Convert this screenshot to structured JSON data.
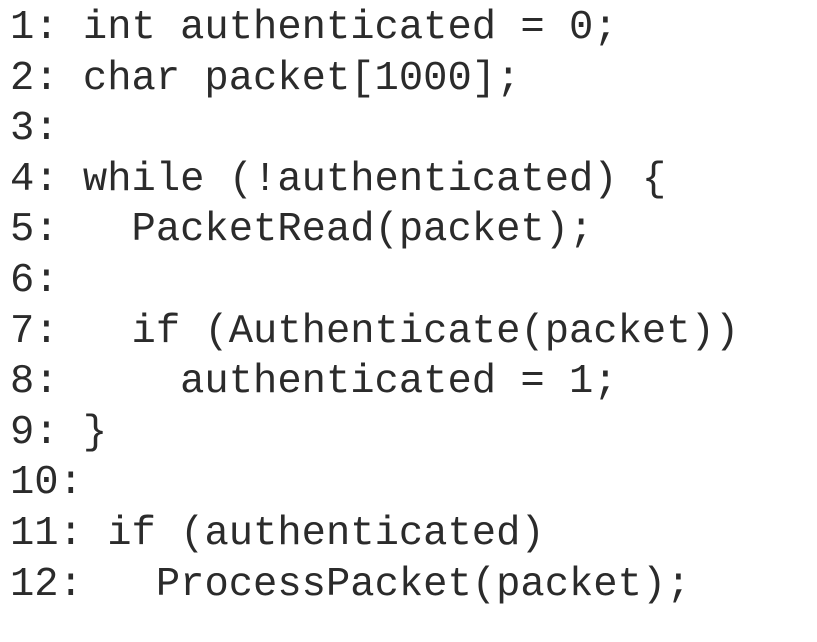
{
  "listing": {
    "lines": [
      {
        "number": "1:",
        "code": " int authenticated = 0;"
      },
      {
        "number": "2:",
        "code": " char packet[1000];"
      },
      {
        "number": "3:",
        "code": ""
      },
      {
        "number": "4:",
        "code": " while (!authenticated) {"
      },
      {
        "number": "5:",
        "code": "   PacketRead(packet);"
      },
      {
        "number": "6:",
        "code": ""
      },
      {
        "number": "7:",
        "code": "   if (Authenticate(packet))"
      },
      {
        "number": "8:",
        "code": "     authenticated = 1;"
      },
      {
        "number": "9:",
        "code": " }"
      },
      {
        "number": "10:",
        "code": ""
      },
      {
        "number": "11:",
        "code": " if (authenticated)"
      },
      {
        "number": "12:",
        "code": "   ProcessPacket(packet);"
      }
    ]
  }
}
